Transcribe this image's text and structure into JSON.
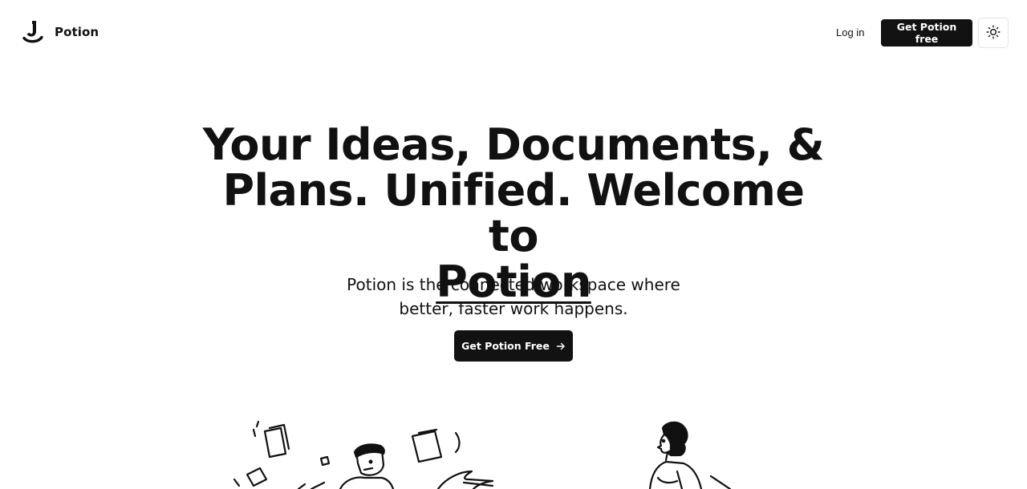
{
  "header": {
    "brand_name": "Potion",
    "logo_icon": "potion-logo-icon",
    "login_label": "Log in",
    "get_free_label": "Get Potion free",
    "theme_icon": "sun-icon"
  },
  "hero": {
    "title_line1": "Your Ideas, Documents, &",
    "title_line2": "Plans. Unified. Welcome to",
    "title_highlight": "Potion",
    "subtitle_line1": "Potion is the connected workspace where",
    "subtitle_line2": "better, faster work happens.",
    "cta_label": "Get Potion Free",
    "cta_icon": "arrow-right-icon"
  },
  "illustrations": {
    "left_icon": "man-with-flying-papers-illustration",
    "right_icon": "woman-working-illustration"
  },
  "colors": {
    "background": "#ffffff",
    "text": "#111111",
    "button_bg": "#121212",
    "button_text": "#ffffff",
    "border": "#e3e3e3"
  }
}
